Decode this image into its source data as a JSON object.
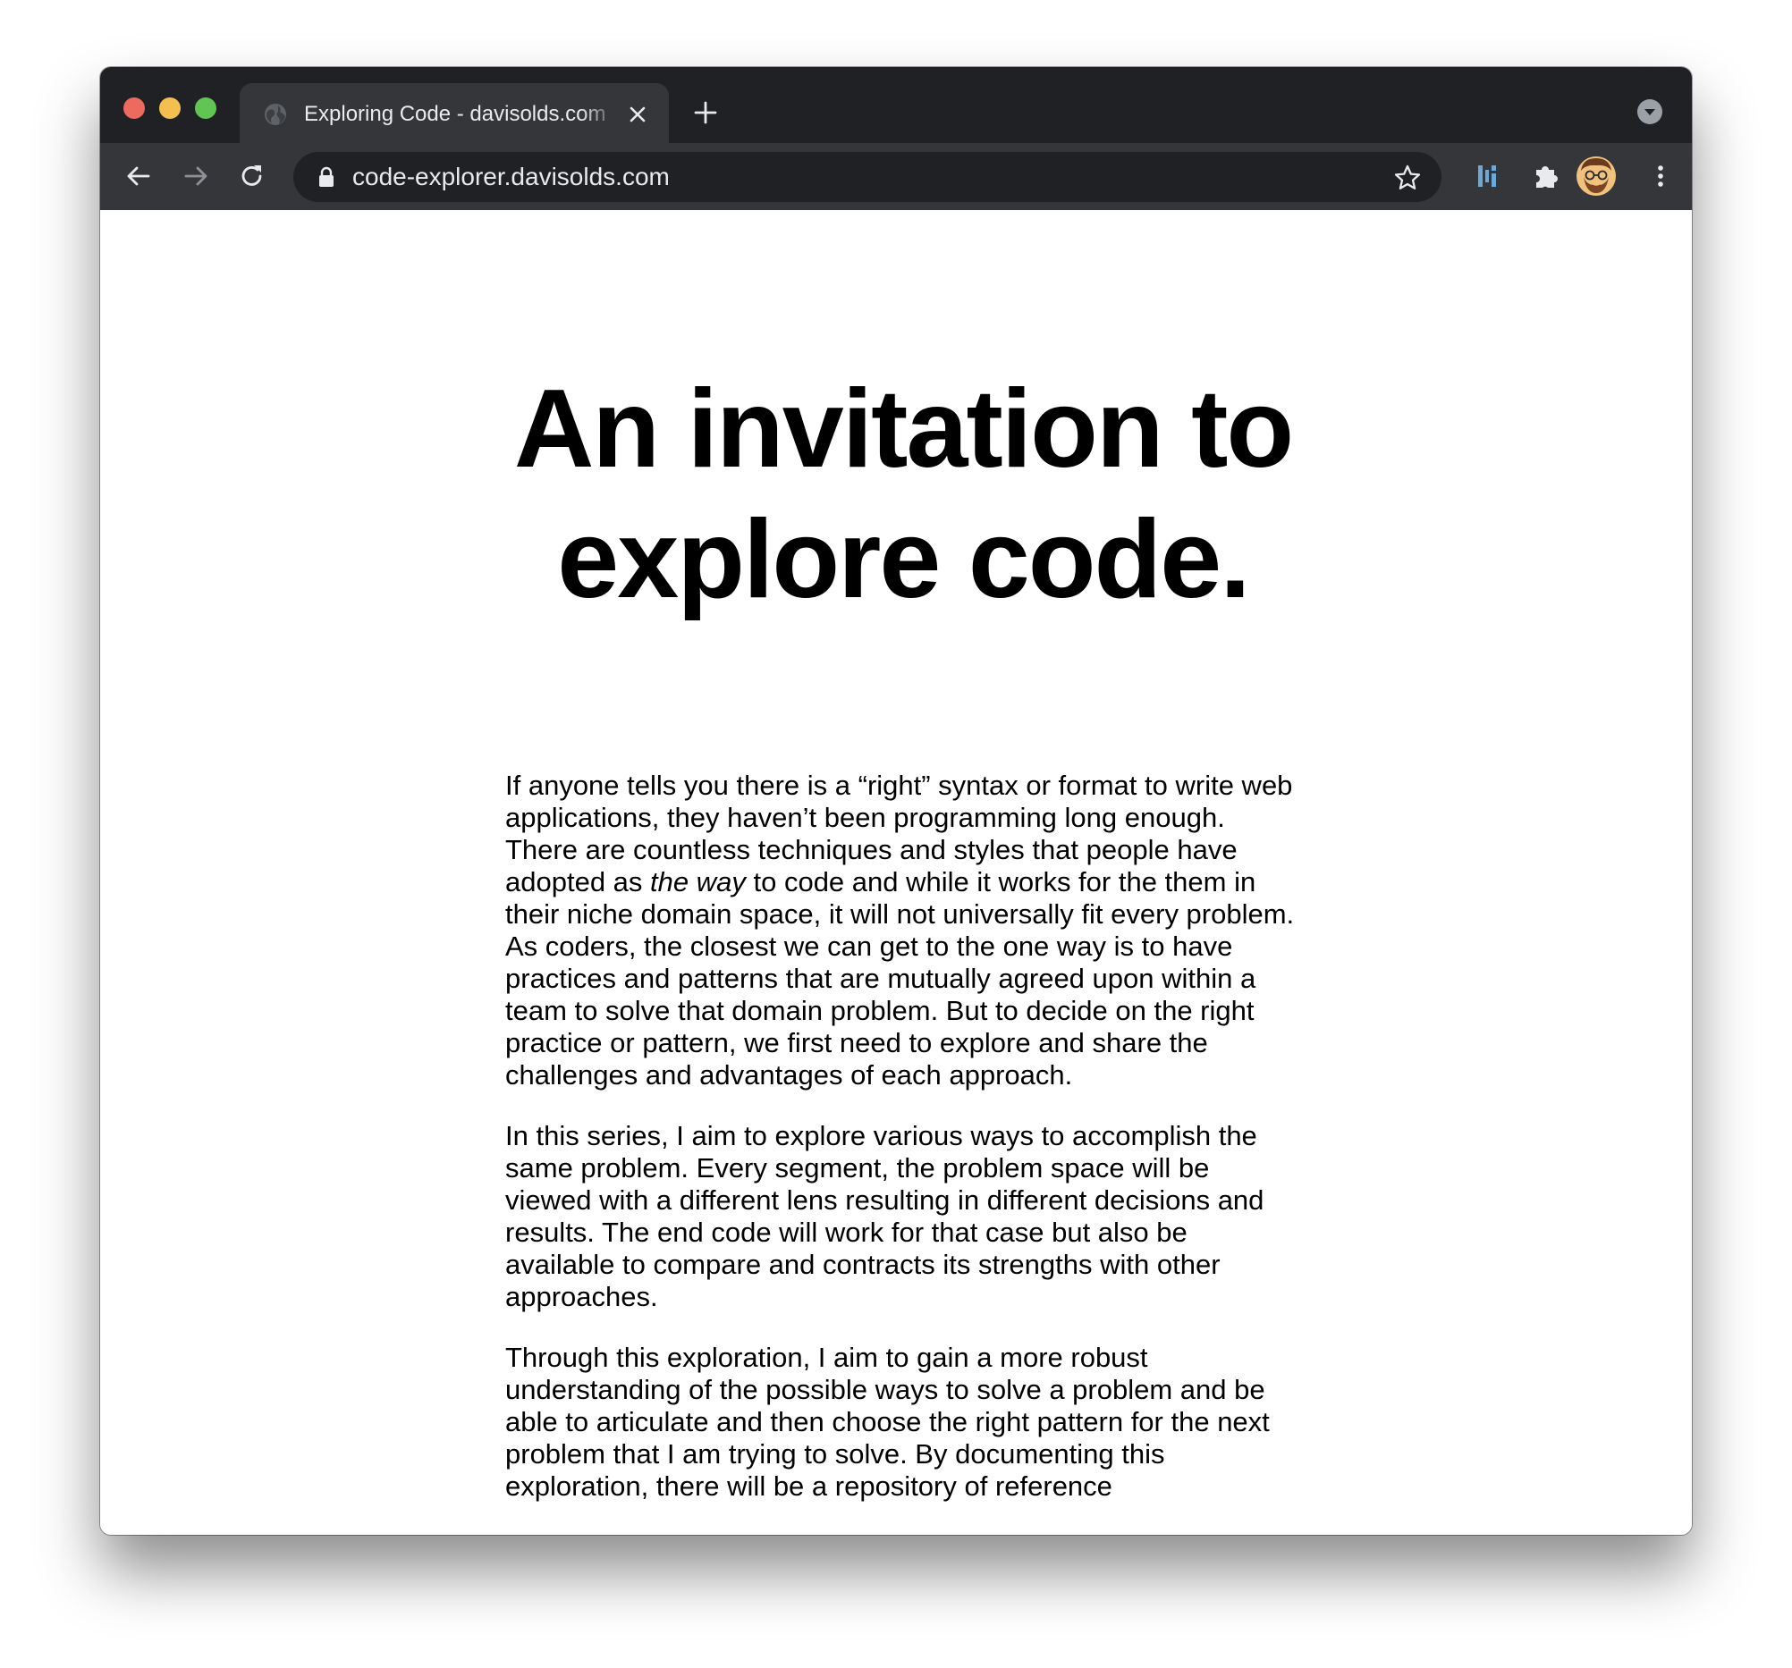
{
  "browser": {
    "tab": {
      "title": "Exploring Code - davisolds.com",
      "favicon": "globe-icon"
    },
    "address_bar": {
      "url": "code-explorer.davisolds.com"
    },
    "icons": {
      "back": "back-arrow-icon",
      "forward": "forward-arrow-icon",
      "reload": "reload-icon",
      "bookmark": "star-icon",
      "extension": "dashboard-extension-icon",
      "extensions_menu": "puzzle-icon",
      "profile": "avatar",
      "menu": "kebab-menu-icon"
    },
    "colors": {
      "tabstrip": "#202124",
      "toolbar": "#35363a",
      "omnibox": "#202124",
      "text": "#e8eaed",
      "close_button": "#ed6a5e",
      "minimize_button": "#f4bf4f",
      "zoom_button": "#61c554"
    }
  },
  "page": {
    "headline": "An invitation to explore code.",
    "paragraphs": [
      {
        "before": "If anyone tells you there is a “right” syntax or format to write web applications, they haven’t been programming long enough. There are countless techniques and styles that people have adopted as ",
        "emphasis": "the way",
        "after": " to code and while it works for the them in their niche domain space, it will not universally fit every problem. As coders, the closest we can get to the one way is to have practices and patterns that are mutually agreed upon within a team to solve that domain problem. But to decide on the right practice or pattern, we first need to explore and share the challenges and advantages of each approach."
      },
      {
        "text": "In this series, I aim to explore various ways to accomplish the same problem. Every segment, the problem space will be viewed with a different lens resulting in different decisions and results. The end code will work for that case but also be available to compare and contracts its strengths with other approaches."
      },
      {
        "text": "Through this exploration, I aim to gain a more robust understanding of the possible ways to solve a problem and be able to articulate and then choose the right pattern for the next problem that I am trying to solve. By documenting this exploration, there will be a repository of reference"
      }
    ]
  }
}
